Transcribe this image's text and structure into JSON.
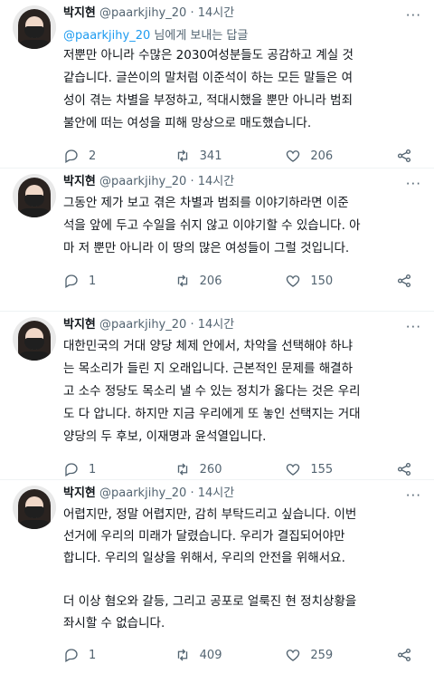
{
  "tweets": [
    {
      "name": "박지현",
      "handle": "@paarkjihy_20",
      "dot": "·",
      "time": "14시간",
      "reply_mention": "@paarkjihy_20",
      "reply_suffix": " 님에게 보내는 답글",
      "text": "저뿐만 아니라 수많은 2030여성분들도 공감하고 계실 것\n같습니다. 글쓴이의 말처럼 이준석이 하는 모든 말들은 여\n성이 겪는 차별을 부정하고, 적대시했을 뿐만 아니라 범죄\n불안에 떠는 여성을 피해 망상으로 매도했습니다.",
      "replies": "2",
      "retweets": "341",
      "likes": "206"
    },
    {
      "name": "박지현",
      "handle": "@paarkjihy_20",
      "dot": "·",
      "time": "14시간",
      "text": "그동안 제가 보고 겪은 차별과 범죄를 이야기하라면 이준\n석을 앞에 두고 수일을 쉬지 않고 이야기할 수 있습니다. 아\n마 저 뿐만 아니라 이 땅의 많은 여성들이 그럴 것입니다.",
      "replies": "1",
      "retweets": "206",
      "likes": "150"
    },
    {
      "name": "박지현",
      "handle": "@paarkjihy_20",
      "dot": "·",
      "time": "14시간",
      "text": "대한민국의 거대 양당 체제 안에서, 차악을 선택해야 하냐\n는 목소리가 들린 지 오래입니다. 근본적인 문제를 해결하\n고 소수 정당도 목소리 낼 수 있는 정치가 옳다는 것은 우리\n도 다 압니다. 하지만 지금 우리에게 또 놓인 선택지는 거대\n양당의 두 후보, 이재명과 윤석열입니다.",
      "replies": "1",
      "retweets": "260",
      "likes": "155"
    },
    {
      "name": "박지현",
      "handle": "@paarkjihy_20",
      "dot": "·",
      "time": "14시간",
      "text": "어렵지만, 정말 어렵지만, 감히 부탁드리고 싶습니다. 이번\n선거에 우리의 미래가 달렸습니다. 우리가 결집되어야만\n합니다. 우리의 일상을 위해서, 우리의 안전을 위해서요.\n\n더 이상 혐오와 갈등, 그리고 공포로 얼룩진 현 정치상황을\n좌시할 수 없습니다.",
      "replies": "1",
      "retweets": "409",
      "likes": "259"
    }
  ],
  "icons": {
    "reply": "reply-icon",
    "retweet": "retweet-icon",
    "like": "heart-icon",
    "share": "share-icon",
    "more": "more-icon"
  },
  "colors": {
    "text": "#0f1419",
    "muted": "#536471",
    "link": "#1d9bf0"
  }
}
